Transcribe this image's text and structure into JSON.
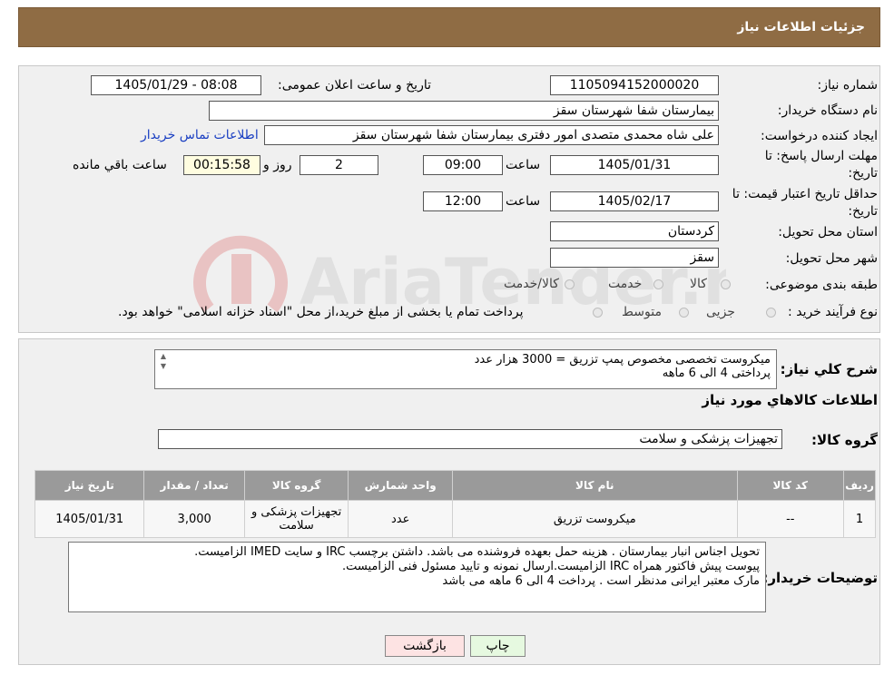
{
  "header": {
    "title": "جزئیات اطلاعات نیاز"
  },
  "form": {
    "need_number_label": "شماره نیاز:",
    "need_number": "1105094152000020",
    "announce_label": "تاریخ و ساعت اعلان عمومی:",
    "announce_value": "1405/01/29 - 08:08",
    "buyer_org_label": "نام دستگاه خریدار:",
    "buyer_org": "بیمارستان شفا شهرستان سقز",
    "requester_label": "ایجاد کننده درخواست:",
    "requester": "علی شاه محمدی متصدی امور دفتری بیمارستان شفا شهرستان سقز",
    "contact_link": "اطلاعات تماس خریدار",
    "deadline_label_1": "مهلت ارسال پاسخ: تا",
    "deadline_label_2": "تاریخ:",
    "deadline_date": "1405/01/31",
    "time_label": "ساعت",
    "deadline_time": "09:00",
    "days_value": "2",
    "days_label": "روز و",
    "remaining_value": "00:15:58",
    "remaining_label": "ساعت باقي مانده",
    "price_valid_label_1": "حداقل تاریخ اعتبار قیمت: تا",
    "price_valid_label_2": "تاریخ:",
    "price_valid_date": "1405/02/17",
    "price_valid_time": "12:00",
    "province_label": "استان محل تحویل:",
    "province": "کردستان",
    "city_label": "شهر محل تحویل:",
    "city": "سقز",
    "category_label": "طبقه بندی موضوعی:",
    "category_options": [
      "کالا",
      "خدمت",
      "کالا/خدمت"
    ],
    "process_label": "نوع فرآیند خرید :",
    "process_options": [
      "جزیی",
      "متوسط"
    ],
    "process_note": "پرداخت تمام یا بخشی از مبلغ خرید،از محل \"اسناد خزانه اسلامی\" خواهد بود."
  },
  "description": {
    "label": "شرح کلي نياز:",
    "line1": "میکروست تخصصی مخصوص پمپ تزریق = 3000 هزار عدد",
    "line2": "پرداختی 4 الی 6 ماهه"
  },
  "goods_section_title": "اطلاعات کالاهاي مورد نياز",
  "goods_group": {
    "label": "گروه کالا:",
    "value": "تجهیزات پزشکی و سلامت"
  },
  "table": {
    "headers": [
      "ردیف",
      "کد کالا",
      "نام کالا",
      "واحد شمارش",
      "گروه کالا",
      "تعداد / مقدار",
      "تاریخ نیاز"
    ],
    "rows": [
      [
        "1",
        "--",
        "میکروست تزریق",
        "عدد",
        "تجهیزات پزشکی و سلامت",
        "3,000",
        "1405/01/31"
      ]
    ]
  },
  "buyer_notes": {
    "label": "توضیحات خریدار:",
    "line1": "تحویل اجناس انبار بیمارستان . هزینه حمل بعهده فروشنده می باشد. داشتن برچسب IRC و سایت IMED الزامیست.",
    "line2": "پیوست پیش فاکتور همراه IRC الزامیست.ارسال نمونه و تایید مسئول فنی الزامیست.",
    "line3": "مارک معتبر ایرانی مدنظر است . پرداخت 4 الی 6 ماهه می باشد"
  },
  "buttons": {
    "print": "چاپ",
    "back": "بازگشت"
  },
  "colors": {
    "header_bg": "#8f6c44",
    "print_btn": "#e6f9e0",
    "back_btn": "#fde3e3"
  },
  "watermark_text": "AriaTender.neT"
}
